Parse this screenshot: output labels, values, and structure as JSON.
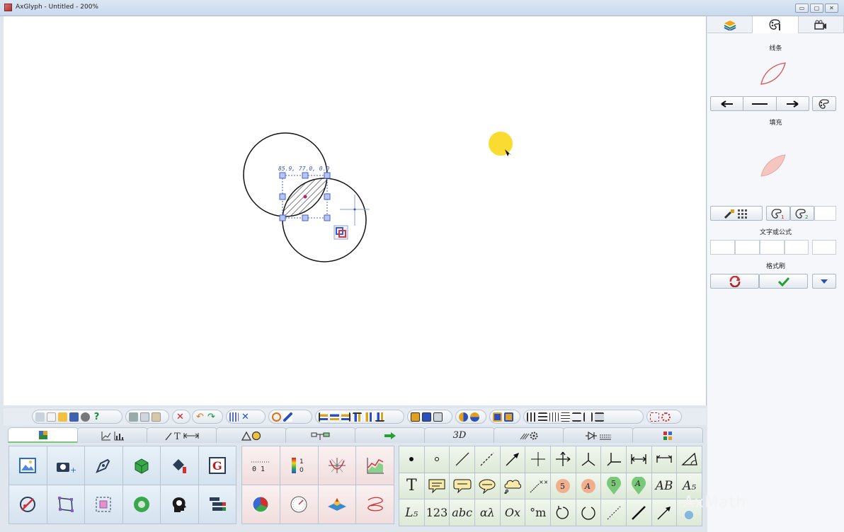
{
  "window": {
    "title": "AxGlyph - Untitled - 200%",
    "buttons": [
      "▭",
      "▢",
      "✕"
    ]
  },
  "canvas": {
    "coord_readout": "85.9, 77.0, 0.0"
  },
  "panel": {
    "tabs": [
      "layers-icon",
      "palette-icon",
      "camera-icon"
    ],
    "stroke_label": "线条",
    "fill_label": "填充",
    "text_label": "文字或公式",
    "format_brush_label": "格式刷",
    "stroke_color": "#e05050",
    "fill_color": "#f5c6c0"
  },
  "bottom_tabs": [
    "image-tab",
    "chart-tab",
    "line-text-tab",
    "shapes-tab",
    "connector-tab",
    "arrow-tab",
    "3D",
    "gear-tab",
    "circuit-tab",
    "grid-tab"
  ],
  "tab_3d_label": "3D",
  "grid_right": {
    "row2": [
      "T",
      "",
      "",
      "",
      "",
      "",
      "5",
      "A",
      "5",
      "A",
      "AB",
      "A₅"
    ],
    "row3": [
      "L₅",
      "123",
      "abc",
      "αλ",
      "Ox",
      "°m",
      "",
      "",
      "",
      "",
      "",
      ""
    ]
  },
  "grid_mid": {
    "readout_label": "0 1",
    "colorbar_label": "1\n0"
  },
  "watermark": "AxMath"
}
